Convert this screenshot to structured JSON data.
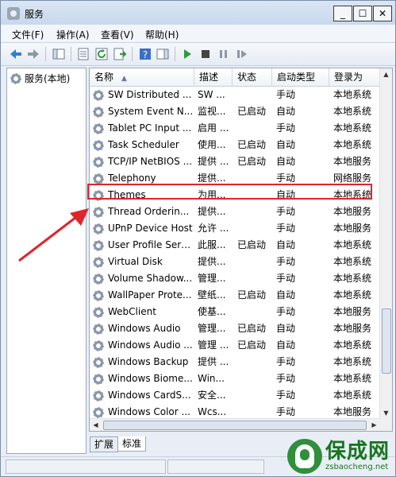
{
  "window": {
    "title": "服务"
  },
  "menu": [
    "文件(F)",
    "操作(A)",
    "查看(V)",
    "帮助(H)"
  ],
  "toolbar": {
    "icons": [
      "back-arrow",
      "forward-arrow",
      "show-tree",
      "properties",
      "refresh",
      "export-list",
      "help",
      "show-hide-action",
      "start-service",
      "stop-service",
      "pause-service",
      "restart-service"
    ]
  },
  "tree": {
    "root_label": "服务(本地)"
  },
  "columns": {
    "name": "名称",
    "desc": "描述",
    "status": "状态",
    "startup": "启动类型",
    "logon": "登录为"
  },
  "services": [
    {
      "name": "SW Distributed ...",
      "desc": "SW ...",
      "status": "",
      "startup": "手动",
      "logon": "本地系统"
    },
    {
      "name": "System Event N...",
      "desc": "监视...",
      "status": "已启动",
      "startup": "自动",
      "logon": "本地系统"
    },
    {
      "name": "Tablet PC Input ...",
      "desc": "启用 ...",
      "status": "",
      "startup": "手动",
      "logon": "本地系统"
    },
    {
      "name": "Task Scheduler",
      "desc": "使用...",
      "status": "已启动",
      "startup": "自动",
      "logon": "本地系统"
    },
    {
      "name": "TCP/IP NetBIOS ...",
      "desc": "提供 ...",
      "status": "已启动",
      "startup": "自动",
      "logon": "本地服务"
    },
    {
      "name": "Telephony",
      "desc": "提供...",
      "status": "",
      "startup": "手动",
      "logon": "网络服务"
    },
    {
      "name": "Themes",
      "desc": "为用...",
      "status": "",
      "startup": "自动",
      "logon": "本地系统"
    },
    {
      "name": "Thread Orderin...",
      "desc": "提供...",
      "status": "",
      "startup": "手动",
      "logon": "本地服务"
    },
    {
      "name": "UPnP Device Host",
      "desc": "允许 ...",
      "status": "",
      "startup": "手动",
      "logon": "本地服务"
    },
    {
      "name": "User Profile Serv...",
      "desc": "此服...",
      "status": "已启动",
      "startup": "自动",
      "logon": "本地系统"
    },
    {
      "name": "Virtual Disk",
      "desc": "提供...",
      "status": "",
      "startup": "手动",
      "logon": "本地系统"
    },
    {
      "name": "Volume Shadow...",
      "desc": "管理...",
      "status": "",
      "startup": "手动",
      "logon": "本地系统"
    },
    {
      "name": "WallPaper Prote...",
      "desc": "壁纸...",
      "status": "已启动",
      "startup": "自动",
      "logon": "本地系统"
    },
    {
      "name": "WebClient",
      "desc": "使基...",
      "status": "",
      "startup": "手动",
      "logon": "本地服务"
    },
    {
      "name": "Windows Audio",
      "desc": "管理...",
      "status": "已启动",
      "startup": "自动",
      "logon": "本地服务"
    },
    {
      "name": "Windows Audio ...",
      "desc": "管理 ...",
      "status": "已启动",
      "startup": "自动",
      "logon": "本地系统"
    },
    {
      "name": "Windows Backup",
      "desc": "提供 ...",
      "status": "",
      "startup": "手动",
      "logon": "本地系统"
    },
    {
      "name": "Windows Biome...",
      "desc": "Win...",
      "status": "",
      "startup": "手动",
      "logon": "本地系统"
    },
    {
      "name": "Windows CardS...",
      "desc": "安全...",
      "status": "",
      "startup": "手动",
      "logon": "本地系统"
    },
    {
      "name": "Windows Color ...",
      "desc": "Wcs...",
      "status": "",
      "startup": "手动",
      "logon": "本地服务"
    }
  ],
  "tabs": [
    "扩展",
    "标准"
  ],
  "watermark": {
    "brand_cn": "保成网",
    "url": "zsbaocheng.net"
  },
  "colors": {
    "highlight_border": "#e0262a",
    "annotation_arrow": "#e0262a",
    "watermark_green": "#16761f"
  }
}
